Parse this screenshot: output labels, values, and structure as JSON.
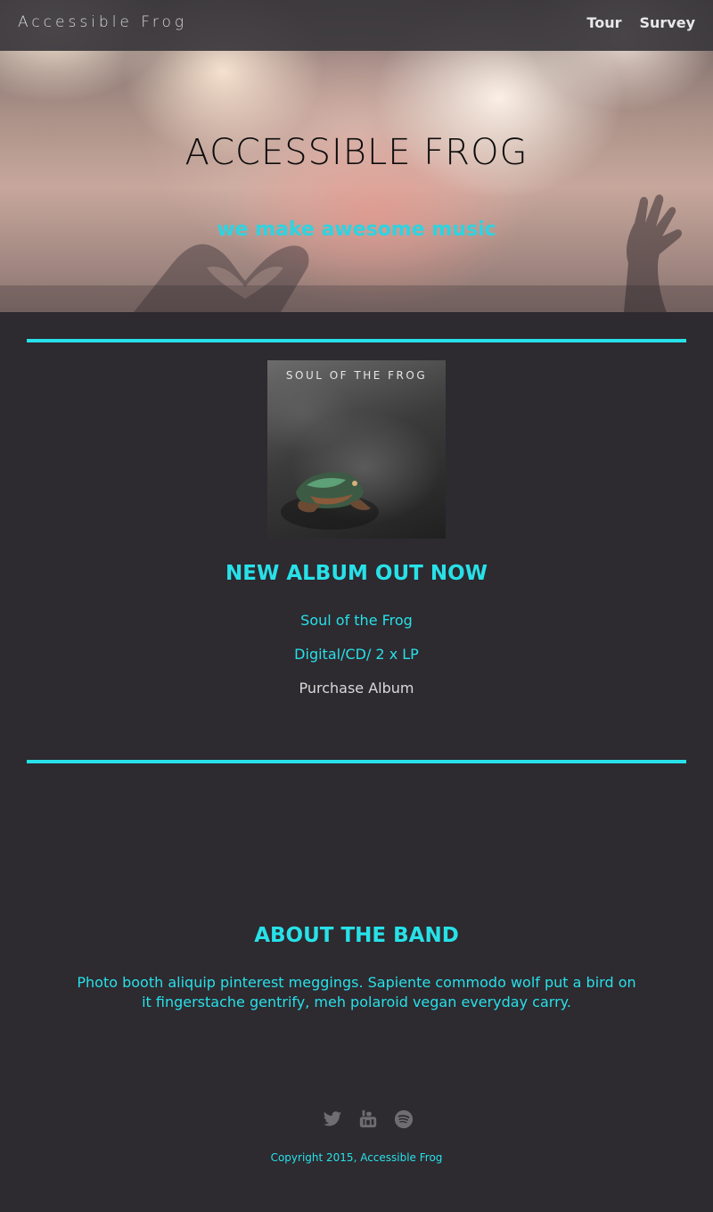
{
  "nav": {
    "brand": "Accessible Frog",
    "links": [
      "Tour",
      "Survey"
    ]
  },
  "hero": {
    "title": "ACCESSIBLE FROG",
    "tagline": "we make awesome music"
  },
  "album": {
    "cover_text": "SOUL OF THE FROG",
    "heading": "NEW ALBUM OUT NOW",
    "name": "Soul of the Frog",
    "formats": "Digital/CD/ 2 x LP",
    "purchase": "Purchase Album"
  },
  "about": {
    "heading": "ABOUT THE BAND",
    "text": "Photo booth aliquip pinterest meggings. Sapiente commodo wolf put a bird on it fingerstache gentrify, meh polaroid vegan everyday carry."
  },
  "footer": {
    "social_icons": [
      "twitter-icon",
      "youtube-icon",
      "spotify-icon"
    ],
    "copyright": "Copyright 2015, Accessible Frog"
  },
  "colors": {
    "accent": "#27e1e8",
    "background": "#2d2a30",
    "navbar": "#3a373c"
  }
}
